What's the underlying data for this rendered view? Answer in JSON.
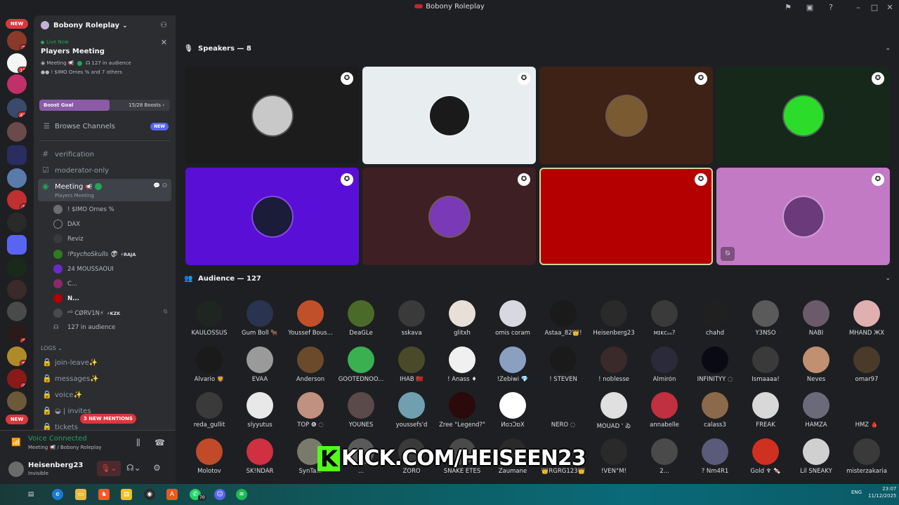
{
  "window": {
    "title": "Bobony Roleplay"
  },
  "servers": {
    "new_top": "NEW",
    "new_bottom": "NEW",
    "badges": [
      "2",
      "12",
      "42",
      "1",
      "3",
      "5",
      "4"
    ]
  },
  "sidebar": {
    "guild_name": "Bobony Roleplay",
    "live": {
      "status": "Live Now",
      "stage_name": "Players Meeting",
      "meta_channel": "Meeting",
      "meta_audience": "127 in audience",
      "meta_speakers": "! $IMO Ornes % and 7 others"
    },
    "boost": {
      "label": "Boost Goal",
      "count": "15/28 Boosts",
      "progress": 0.536
    },
    "browse": {
      "label": "Browse Channels",
      "badge": "NEW"
    },
    "channels": [
      {
        "name": "verification",
        "icon": "#"
      },
      {
        "name": "moderator-only",
        "icon": "☑"
      }
    ],
    "active_channel": {
      "name": "Meeting",
      "subtitle": "Players Meeting"
    },
    "members": [
      {
        "name": "! $IMO Ornes %",
        "tag": "",
        "color": "#6d6d6d"
      },
      {
        "name": "DAX",
        "tag": "",
        "color": "#2b2b2b"
      },
      {
        "name": "Reviz",
        "tag": "",
        "color": "#3a3a3a"
      },
      {
        "name": "!PsychoSkulls 👽",
        "tag": "⚡RAJA",
        "color": "#2f7a22"
      },
      {
        "name": "24 MOUSSAOUI",
        "tag": "",
        "color": "#6a2cc8"
      },
      {
        "name": "C...",
        "tag": "",
        "color": "#8a2a6a"
      },
      {
        "name": "N...",
        "tag": "",
        "color": "#b00000"
      },
      {
        "name": "ᵒᴳ CØRV1N⚡",
        "tag": "⚡KZK",
        "color": "#4a4a4a"
      }
    ],
    "audience_count": "127 in audience",
    "logs_category": "LOGS",
    "log_channels": [
      "join-leave✨",
      "messages✨",
      "voice✨",
      "◒ | invites"
    ],
    "partial_channel": "tickets",
    "mentions_pill": "3 NEW MENTIONS",
    "voice": {
      "status": "Voice Connected",
      "channel": "Meeting",
      "server": "/ Bobony Roleplay"
    },
    "user": {
      "name": "Heisenberg23",
      "status": "Invisible"
    }
  },
  "main": {
    "speakers_header": "Speakers — 8",
    "audience_header": "Audience — 127",
    "speakers": [
      {
        "bg": "#1c1c1c",
        "av": "#c8c8c8"
      },
      {
        "bg": "#e8eef0",
        "av": "#1a1a1a"
      },
      {
        "bg": "#3e2216",
        "av": "#7a5a30"
      },
      {
        "bg": "#16281a",
        "av": "#2bdc2b"
      },
      {
        "bg": "#5a0fd6",
        "av": "#1b1b3a"
      },
      {
        "bg": "#3e1f24",
        "av": "#7a3ab8"
      },
      {
        "bg": "#b50000",
        "av": "#b50000"
      },
      {
        "bg": "#c27ac4",
        "av": "#6a3a7a"
      }
    ],
    "audience": [
      {
        "name": "KAULOSSUS",
        "color": "#1f2520"
      },
      {
        "name": "Gum Boll 🐂",
        "color": "#2a3350"
      },
      {
        "name": "Youssef Bous...",
        "color": "#c0502a"
      },
      {
        "name": "DeaGLe",
        "color": "#4a6a2a"
      },
      {
        "name": "sskava",
        "color": "#3a3a3a"
      },
      {
        "name": "glitxh",
        "color": "#e8e0d8"
      },
      {
        "name": "omis coram",
        "color": "#d8d8e0"
      },
      {
        "name": "Astaa_82👑!",
        "color": "#1a1a1a"
      },
      {
        "name": "Heisenberg23",
        "color": "#2a2a2a"
      },
      {
        "name": "ᴍɪᴋᴄₒₒ?",
        "color": "#3a3a3a"
      },
      {
        "name": "chahd",
        "color": "#202020"
      },
      {
        "name": "Y3NSO",
        "color": "#5a5a5a"
      },
      {
        "name": "NABI",
        "color": "#6a5a6a"
      },
      {
        "name": "MHAND ЖX",
        "color": "#e0b0b0"
      },
      {
        "name": "Alvario 🦁",
        "color": "#1a1a1a"
      },
      {
        "name": "EVAA",
        "color": "#9a9a9a"
      },
      {
        "name": "Anderson",
        "color": "#6a4a2a"
      },
      {
        "name": "GOOTEDNOO...",
        "color": "#3ab050"
      },
      {
        "name": "IHAB 🇲🇦",
        "color": "#4a4a2a"
      },
      {
        "name": "! Anass ♦",
        "color": "#f0f0f0"
      },
      {
        "name": "!Zebiwi 💎",
        "color": "#8aa0c0"
      },
      {
        "name": "! STEVEN",
        "color": "#1a1a1a"
      },
      {
        "name": "! noblesse",
        "color": "#3a2a2a"
      },
      {
        "name": "Almirón",
        "color": "#2a2a3a"
      },
      {
        "name": "INFINITYY ◌",
        "color": "#0a0a14"
      },
      {
        "name": "Ismaaaa!",
        "color": "#3a3a3a"
      },
      {
        "name": "Neves",
        "color": "#c09070"
      },
      {
        "name": "omar97",
        "color": "#4a3a2a"
      },
      {
        "name": "reda_gullit",
        "color": "#3a3a3a"
      },
      {
        "name": "slyyutus",
        "color": "#e8e8e8"
      },
      {
        "name": "TOP ❻ ◌",
        "color": "#c09080"
      },
      {
        "name": "YOUNES",
        "color": "#5a4a4a"
      },
      {
        "name": "youssefs'd",
        "color": "#70a0b0"
      },
      {
        "name": "Zree \"Legend?\"",
        "color": "#2a0a0a"
      },
      {
        "name": "ИoɔƆɒX",
        "color": "#ffffff"
      },
      {
        "name": "NERO ◌",
        "color": "#1e1f22"
      },
      {
        "name": "MOUAD ' ゐ",
        "color": "#e0e0e0"
      },
      {
        "name": "annabelle",
        "color": "#c03040"
      },
      {
        "name": "calass3",
        "color": "#8a6a4a"
      },
      {
        "name": "FREAK",
        "color": "#d8d8d8"
      },
      {
        "name": "HAMZA",
        "color": "#6a6a7a"
      },
      {
        "name": "HMZ 🩸",
        "color": "#1e1f22"
      },
      {
        "name": "Molotov",
        "color": "#c04a2a"
      },
      {
        "name": "SK!NDAR",
        "color": "#d03040"
      },
      {
        "name": "SynTa...",
        "color": "#7a7a6a"
      },
      {
        "name": "...",
        "color": "#5a5a5a"
      },
      {
        "name": "ZORO",
        "color": "#3a3a3a"
      },
      {
        "name": "SNAKE ETES",
        "color": "#4a4a4a"
      },
      {
        "name": "Zaumane",
        "color": "#2a2a2a"
      },
      {
        "name": "👑RGRG123👑",
        "color": "#1e1f22"
      },
      {
        "name": "!VEN°M!",
        "color": "#2a2a2a"
      },
      {
        "name": "2...",
        "color": "#4a4a4a"
      },
      {
        "name": "? Nm4R1",
        "color": "#5a5a7a"
      },
      {
        "name": "Gold ♆ 🍬",
        "color": "#d03020"
      },
      {
        "name": "Lil SNEAKY",
        "color": "#d0d0d0"
      },
      {
        "name": "misterzakaria",
        "color": "#3a3a3a"
      }
    ]
  },
  "overlay": {
    "text": "KICK.COM/HEISEEN23"
  },
  "taskbar": {
    "tray_lang": "ENG",
    "time": "23:07",
    "date": "11/12/2025",
    "badge": "70"
  }
}
